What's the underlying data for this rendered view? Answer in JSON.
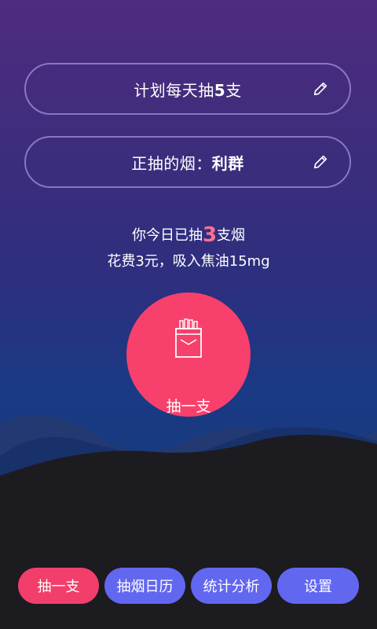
{
  "plan": {
    "prefix": "计划每天抽",
    "count": "5",
    "suffix": "支"
  },
  "brand": {
    "prefix": "正抽的烟：",
    "name": "利群"
  },
  "today": {
    "prefix": "你今日已抽",
    "count": "3",
    "suffix": "支烟",
    "cost_line": "花费3元，吸入焦油15mg"
  },
  "smoke_button": {
    "label": "抽一支"
  },
  "nav": {
    "items": [
      {
        "label": "抽一支"
      },
      {
        "label": "抽烟日历"
      },
      {
        "label": "统计分析"
      },
      {
        "label": "设置"
      }
    ]
  },
  "colors": {
    "accent_pink": "#f7406c",
    "count_pink": "#ff6f93",
    "nav_blue": "#6267f0"
  },
  "icons": [
    "edit-pencil-icon",
    "cigarette-pack-icon"
  ]
}
